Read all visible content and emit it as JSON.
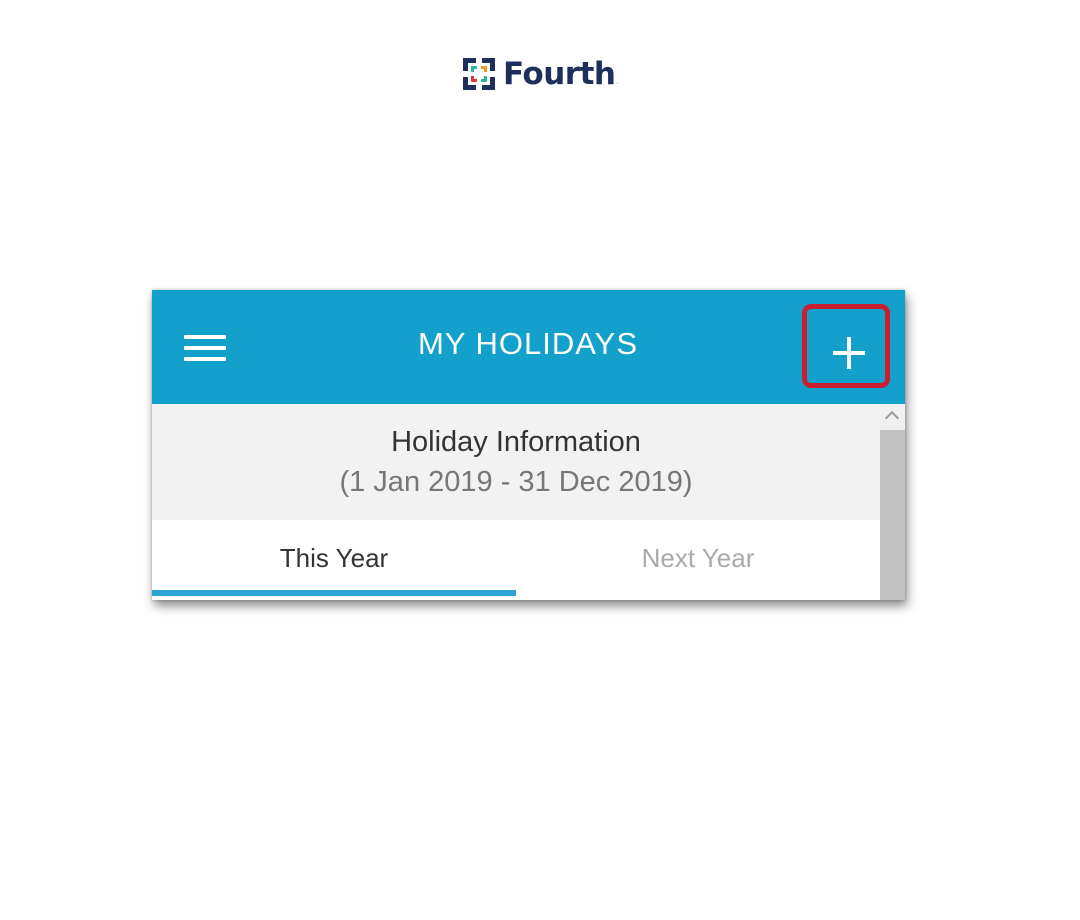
{
  "brand": {
    "name": "Fourth",
    "trademark": ".",
    "colors": {
      "text": "#1f2f5c",
      "mark_teal": "#2bb5a5",
      "mark_orange": "#f39a1d",
      "mark_red": "#e03c31",
      "mark_blue": "#1f2f5c"
    }
  },
  "app": {
    "title": "MY HOLIDAYS",
    "menu_icon": "hamburger-menu-icon",
    "add_icon": "plus-icon",
    "colors": {
      "appbar": "#13a0cd",
      "highlight": "#c8202f",
      "tab_indicator": "#2aa5d6"
    }
  },
  "holiday_info": {
    "title": "Holiday Information",
    "period": "(1 Jan 2019 - 31 Dec 2019)"
  },
  "tabs": [
    {
      "label": "This Year",
      "selected": true
    },
    {
      "label": "Next Year",
      "selected": false
    }
  ],
  "scrollbar": {
    "up_icon": "chevron-up-icon"
  }
}
